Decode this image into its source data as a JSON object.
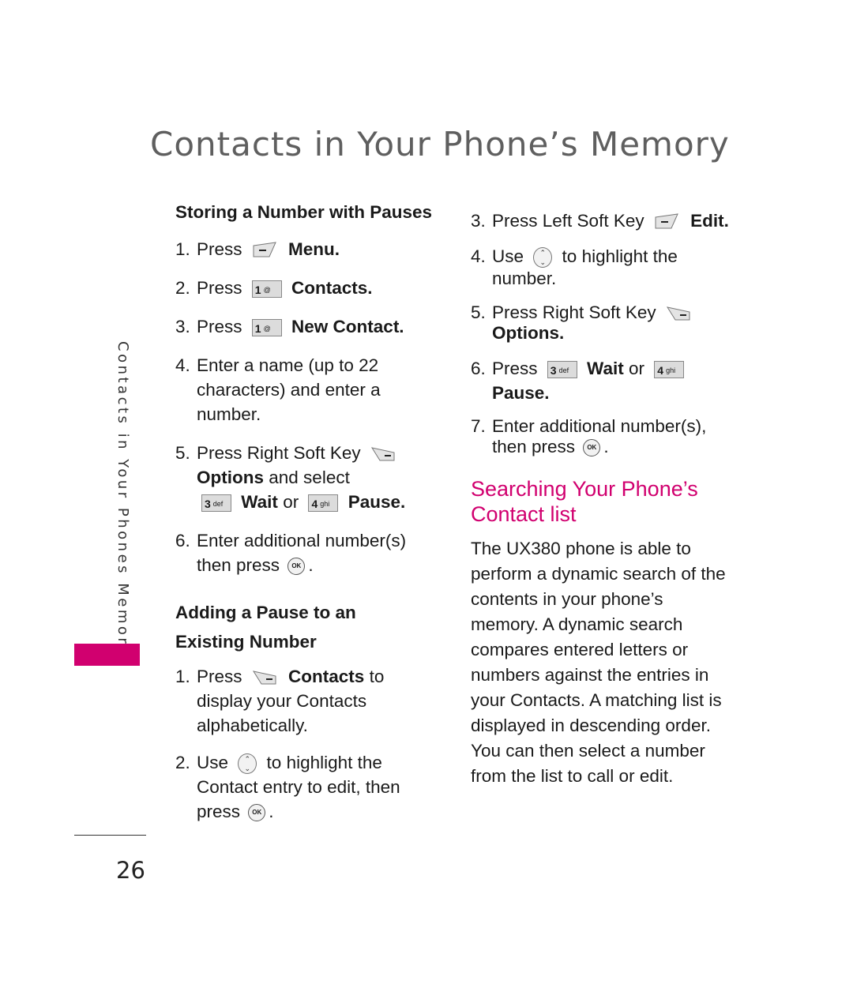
{
  "page": {
    "title": "Contacts in Your Phone’s Memory",
    "side_label": "Contacts in Your Phones Memory",
    "page_number": "26",
    "accent_color": "#d1006f"
  },
  "left": {
    "heading1": "Storing a Number with Pauses",
    "s1": {
      "n": "1.",
      "a": "Press",
      "b": "Menu."
    },
    "s2": {
      "n": "2.",
      "a": "Press",
      "b": "Contacts."
    },
    "s3": {
      "n": "3.",
      "a": "Press",
      "b": "New Contact."
    },
    "s4": {
      "n": "4.",
      "a": "Enter a name (up to 22 characters) and enter a number."
    },
    "s5": {
      "n": "5.",
      "a": "Press Right Soft Key",
      "b": "Options",
      "c": "and select",
      "d": "Wait",
      "e": "or",
      "f": "Pause."
    },
    "s6": {
      "n": "6.",
      "a": "Enter additional number(s) then press",
      "b": "."
    },
    "heading2": "Adding a Pause to an Existing Number",
    "t1": {
      "n": "1.",
      "a": "Press",
      "b": "Contacts",
      "c": "to display your Contacts alphabetically."
    },
    "t2": {
      "n": "2.",
      "a": "Use",
      "b": "to highlight the Contact entry to edit, then press",
      "c": "."
    }
  },
  "right": {
    "t3": {
      "n": "3.",
      "a": "Press Left Soft Key",
      "b": "Edit."
    },
    "t4": {
      "n": "4.",
      "a": "Use",
      "b": "to highlight the number."
    },
    "t5": {
      "n": "5.",
      "a": "Press Right Soft Key",
      "b": "Options."
    },
    "t6": {
      "n": "6.",
      "a": "Press",
      "b": "Wait",
      "c": "or",
      "d": "Pause."
    },
    "t7": {
      "n": "7.",
      "a": "Enter additional number(s), then press",
      "b": "."
    },
    "heading": "Searching Your Phone’s Contact list",
    "paragraph": "The UX380 phone is able to perform a dynamic search of the contents in your phone’s memory. A dynamic search compares entered letters or numbers against the entries in your Contacts. A matching list is displayed in descending order. You can then select a number from the list to call or edit."
  },
  "keys": {
    "k1": "1",
    "k1_sub": "@",
    "k3": "3",
    "k3_sub": "def",
    "k4": "4",
    "k4_sub": "ghi",
    "ok": "OK"
  }
}
